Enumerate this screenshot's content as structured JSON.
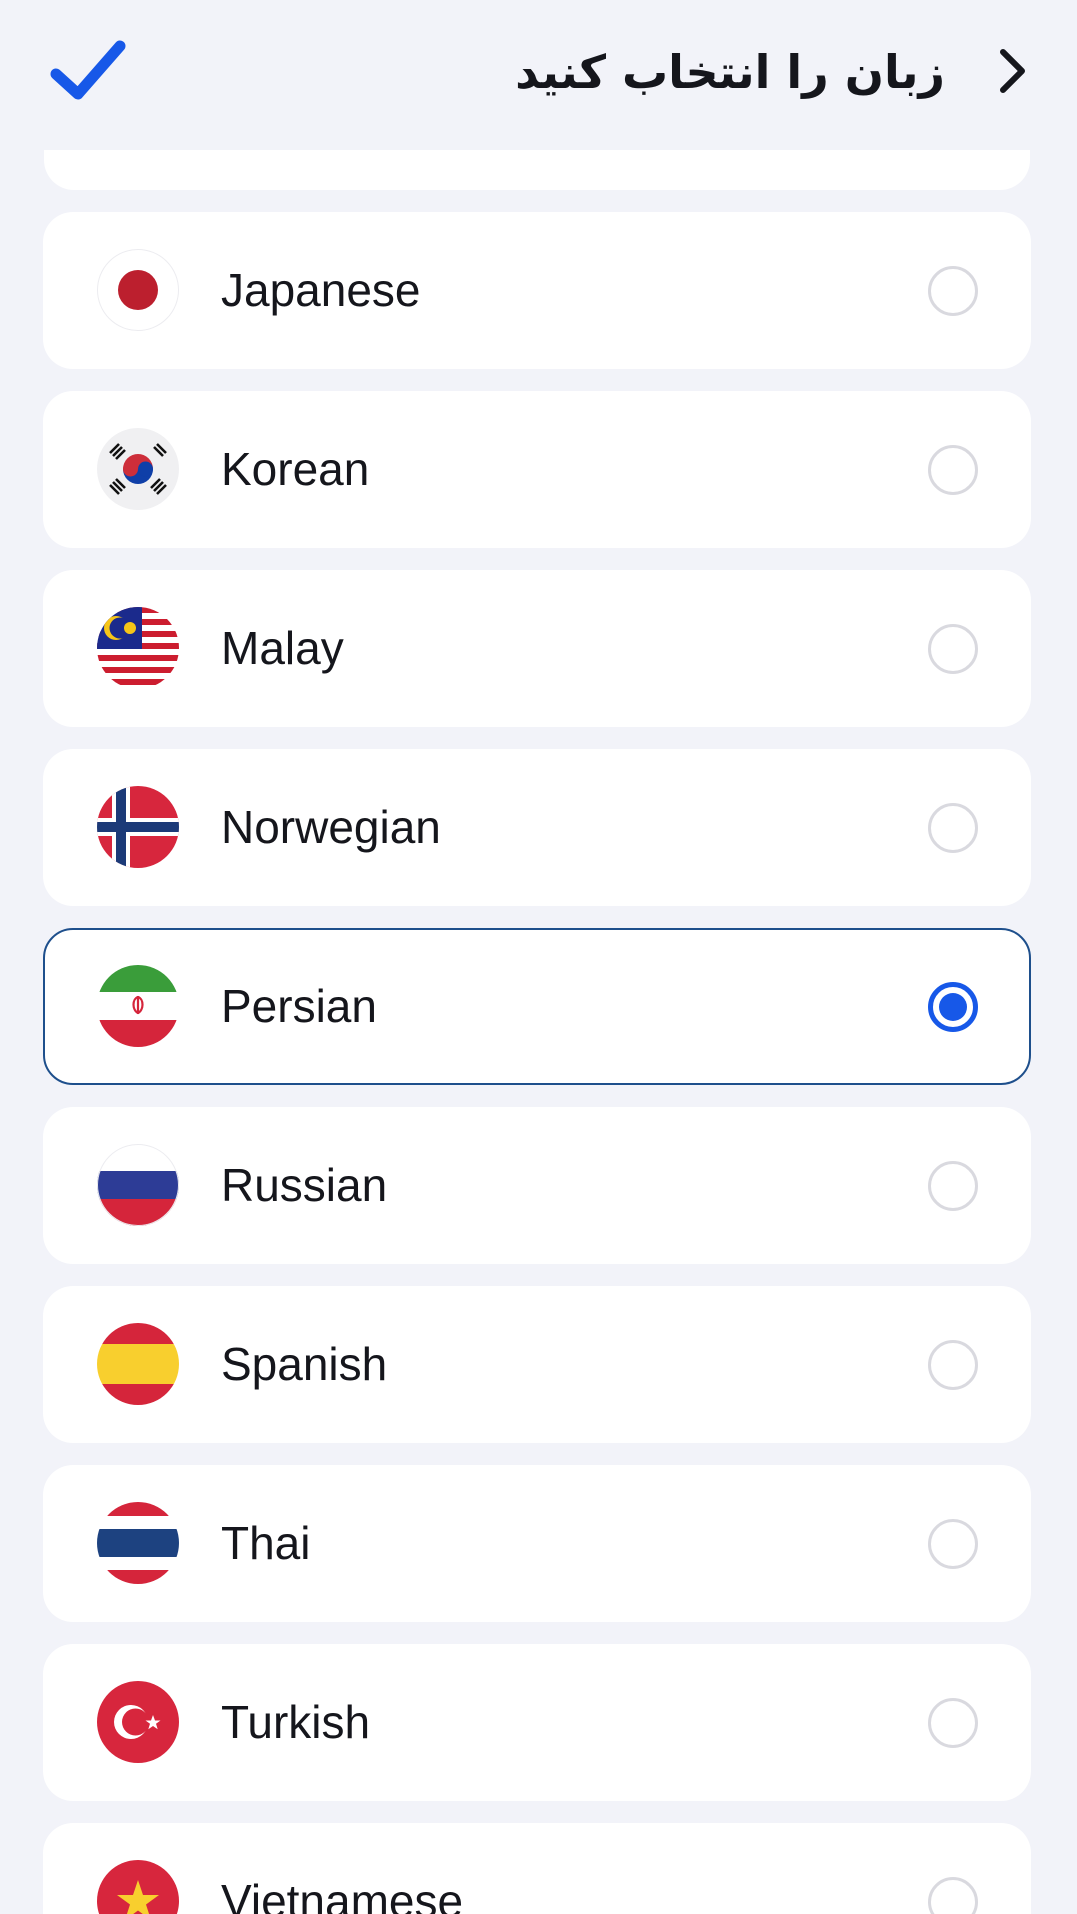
{
  "header": {
    "title": "زبان را انتخاب کنید",
    "confirm_icon": "check-icon",
    "back_icon": "chevron-right-icon",
    "accent_color": "#1758e8"
  },
  "languages": [
    {
      "label": "Japanese",
      "flag": "japan-flag-icon",
      "selected": false
    },
    {
      "label": "Korean",
      "flag": "korea-flag-icon",
      "selected": false
    },
    {
      "label": "Malay",
      "flag": "malaysia-flag-icon",
      "selected": false
    },
    {
      "label": "Norwegian",
      "flag": "norway-flag-icon",
      "selected": false
    },
    {
      "label": "Persian",
      "flag": "iran-flag-icon",
      "selected": true
    },
    {
      "label": "Russian",
      "flag": "russia-flag-icon",
      "selected": false
    },
    {
      "label": "Spanish",
      "flag": "spain-flag-icon",
      "selected": false
    },
    {
      "label": "Thai",
      "flag": "thailand-flag-icon",
      "selected": false
    },
    {
      "label": "Turkish",
      "flag": "turkey-flag-icon",
      "selected": false
    },
    {
      "label": "Vietnamese",
      "flag": "vietnam-flag-icon",
      "selected": false
    }
  ]
}
